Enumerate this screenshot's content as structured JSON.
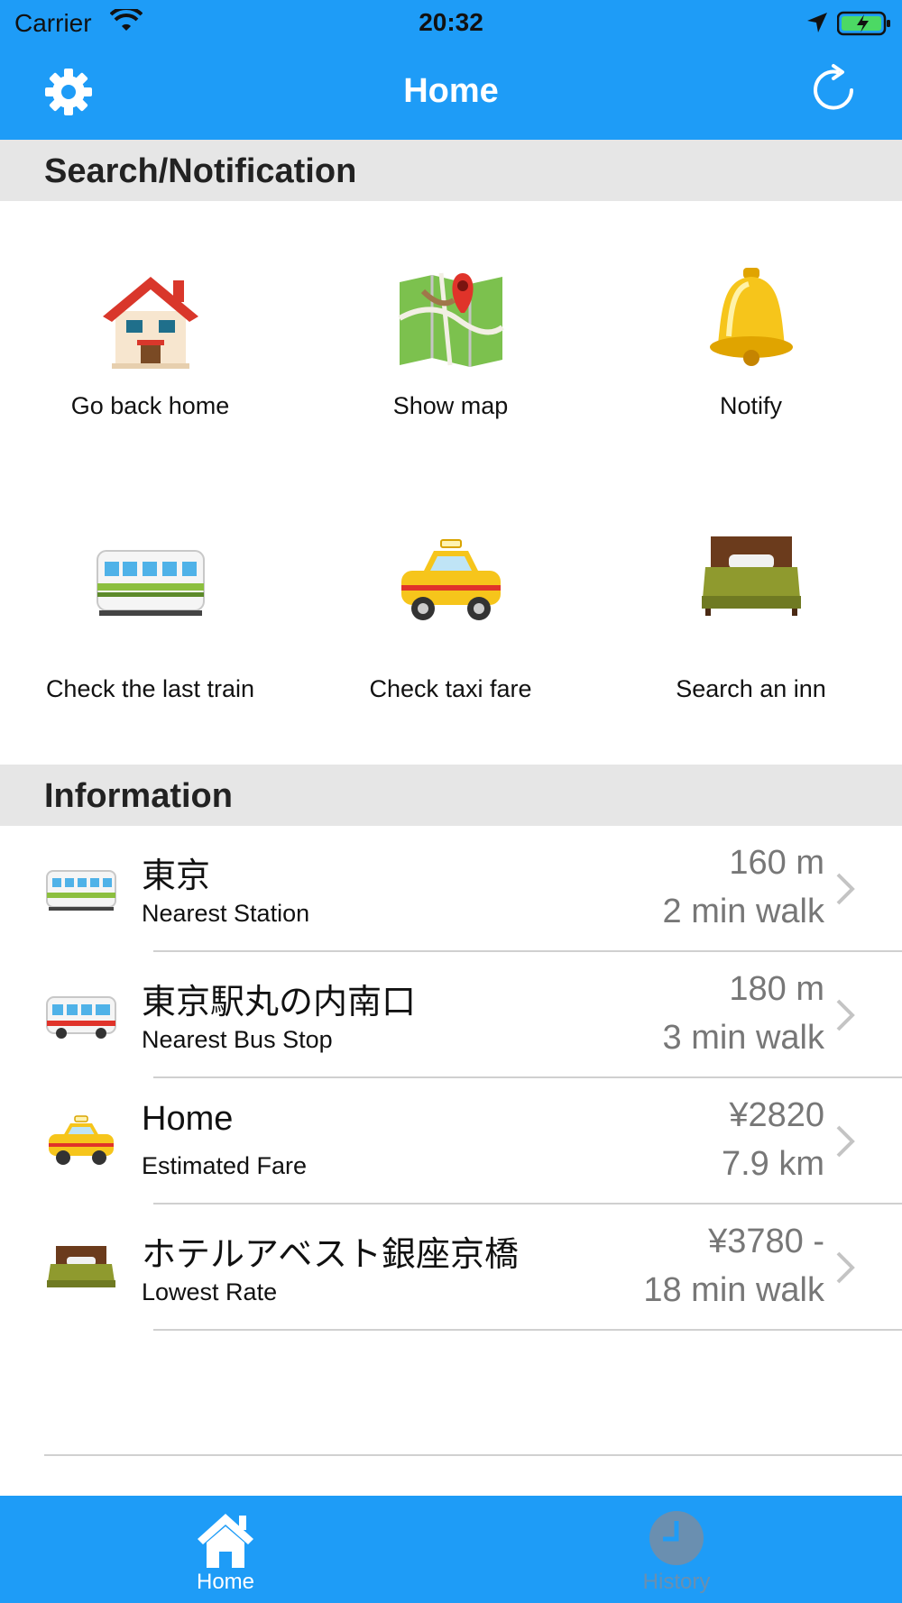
{
  "status_bar": {
    "carrier": "Carrier",
    "time": "20:32"
  },
  "nav": {
    "title": "Home",
    "left_icon": "gear-icon",
    "right_icon": "refresh-icon"
  },
  "sections": {
    "search": "Search/Notification",
    "info": "Information"
  },
  "grid": [
    {
      "label": "Go back home",
      "icon": "house-icon"
    },
    {
      "label": "Show map",
      "icon": "map-icon"
    },
    {
      "label": "Notify",
      "icon": "bell-icon"
    },
    {
      "label": "Check the last train",
      "icon": "train-icon"
    },
    {
      "label": "Check taxi fare",
      "icon": "taxi-icon"
    },
    {
      "label": "Search an inn",
      "icon": "bed-icon"
    }
  ],
  "info_rows": [
    {
      "icon": "train-icon",
      "title": "東京",
      "subtitle": "Nearest Station",
      "value1": "160 m",
      "value2": "2 min walk"
    },
    {
      "icon": "bus-icon",
      "title": "東京駅丸の内南口",
      "subtitle": "Nearest Bus Stop",
      "value1": "180 m",
      "value2": "3 min walk"
    },
    {
      "icon": "taxi-icon",
      "title": "Home",
      "subtitle": "Estimated Fare",
      "value1": "¥2820",
      "value2": "7.9 km"
    },
    {
      "icon": "bed-icon",
      "title": "ホテルアベスト銀座京橋",
      "subtitle": "Lowest Rate",
      "value1": "¥3780 -",
      "value2": "18 min walk"
    }
  ],
  "tabs": [
    {
      "label": "Home",
      "icon": "house-icon",
      "active": true
    },
    {
      "label": "History",
      "icon": "clock-icon",
      "active": false
    }
  ],
  "colors": {
    "accent": "#1e9cf7",
    "section_header": "#e6e6e6",
    "secondary_text": "#777777",
    "tab_inactive": "#6a8fb0"
  }
}
